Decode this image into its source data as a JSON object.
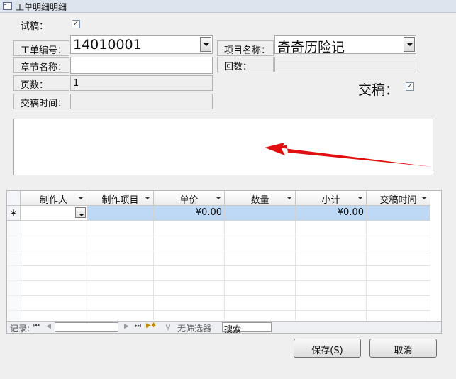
{
  "window": {
    "title": "工单明细明细"
  },
  "trial": {
    "label": "试稿：",
    "checked": "✓"
  },
  "form": {
    "order_no_label": "工单编号：",
    "order_no_value": "14010001",
    "project_label": "项目名称：",
    "project_value": "奇奇历险记",
    "chapter_label": "章节名称：",
    "chapter_value": "",
    "episode_label": "回数：",
    "episode_value": "",
    "pages_label": "页数：",
    "pages_value": "1",
    "submit_time_label": "交稿时间：",
    "submit_time_value": "",
    "submitted_label": "交稿：",
    "submitted_checked": "✓"
  },
  "table": {
    "columns": [
      "制作人",
      "制作项目",
      "单价",
      "数量",
      "小计",
      "交稿时间"
    ],
    "new_row_marker": "∗",
    "new_row": {
      "maker": "",
      "item": "",
      "unit_price": "¥0.00",
      "quantity": "",
      "subtotal": "¥0.00",
      "submit_time": ""
    }
  },
  "nav": {
    "record_label": "记录:",
    "first": "⏮",
    "prev": "◀",
    "next": "▶",
    "last": "⏭",
    "new": "▶✱",
    "filter_label": "无筛选器",
    "search_placeholder": "搜索",
    "record_value": ""
  },
  "buttons": {
    "save": "保存(S)",
    "cancel": "取消"
  },
  "colors": {
    "selected_row": "#bdd9f6",
    "arrow": "#e01010"
  }
}
